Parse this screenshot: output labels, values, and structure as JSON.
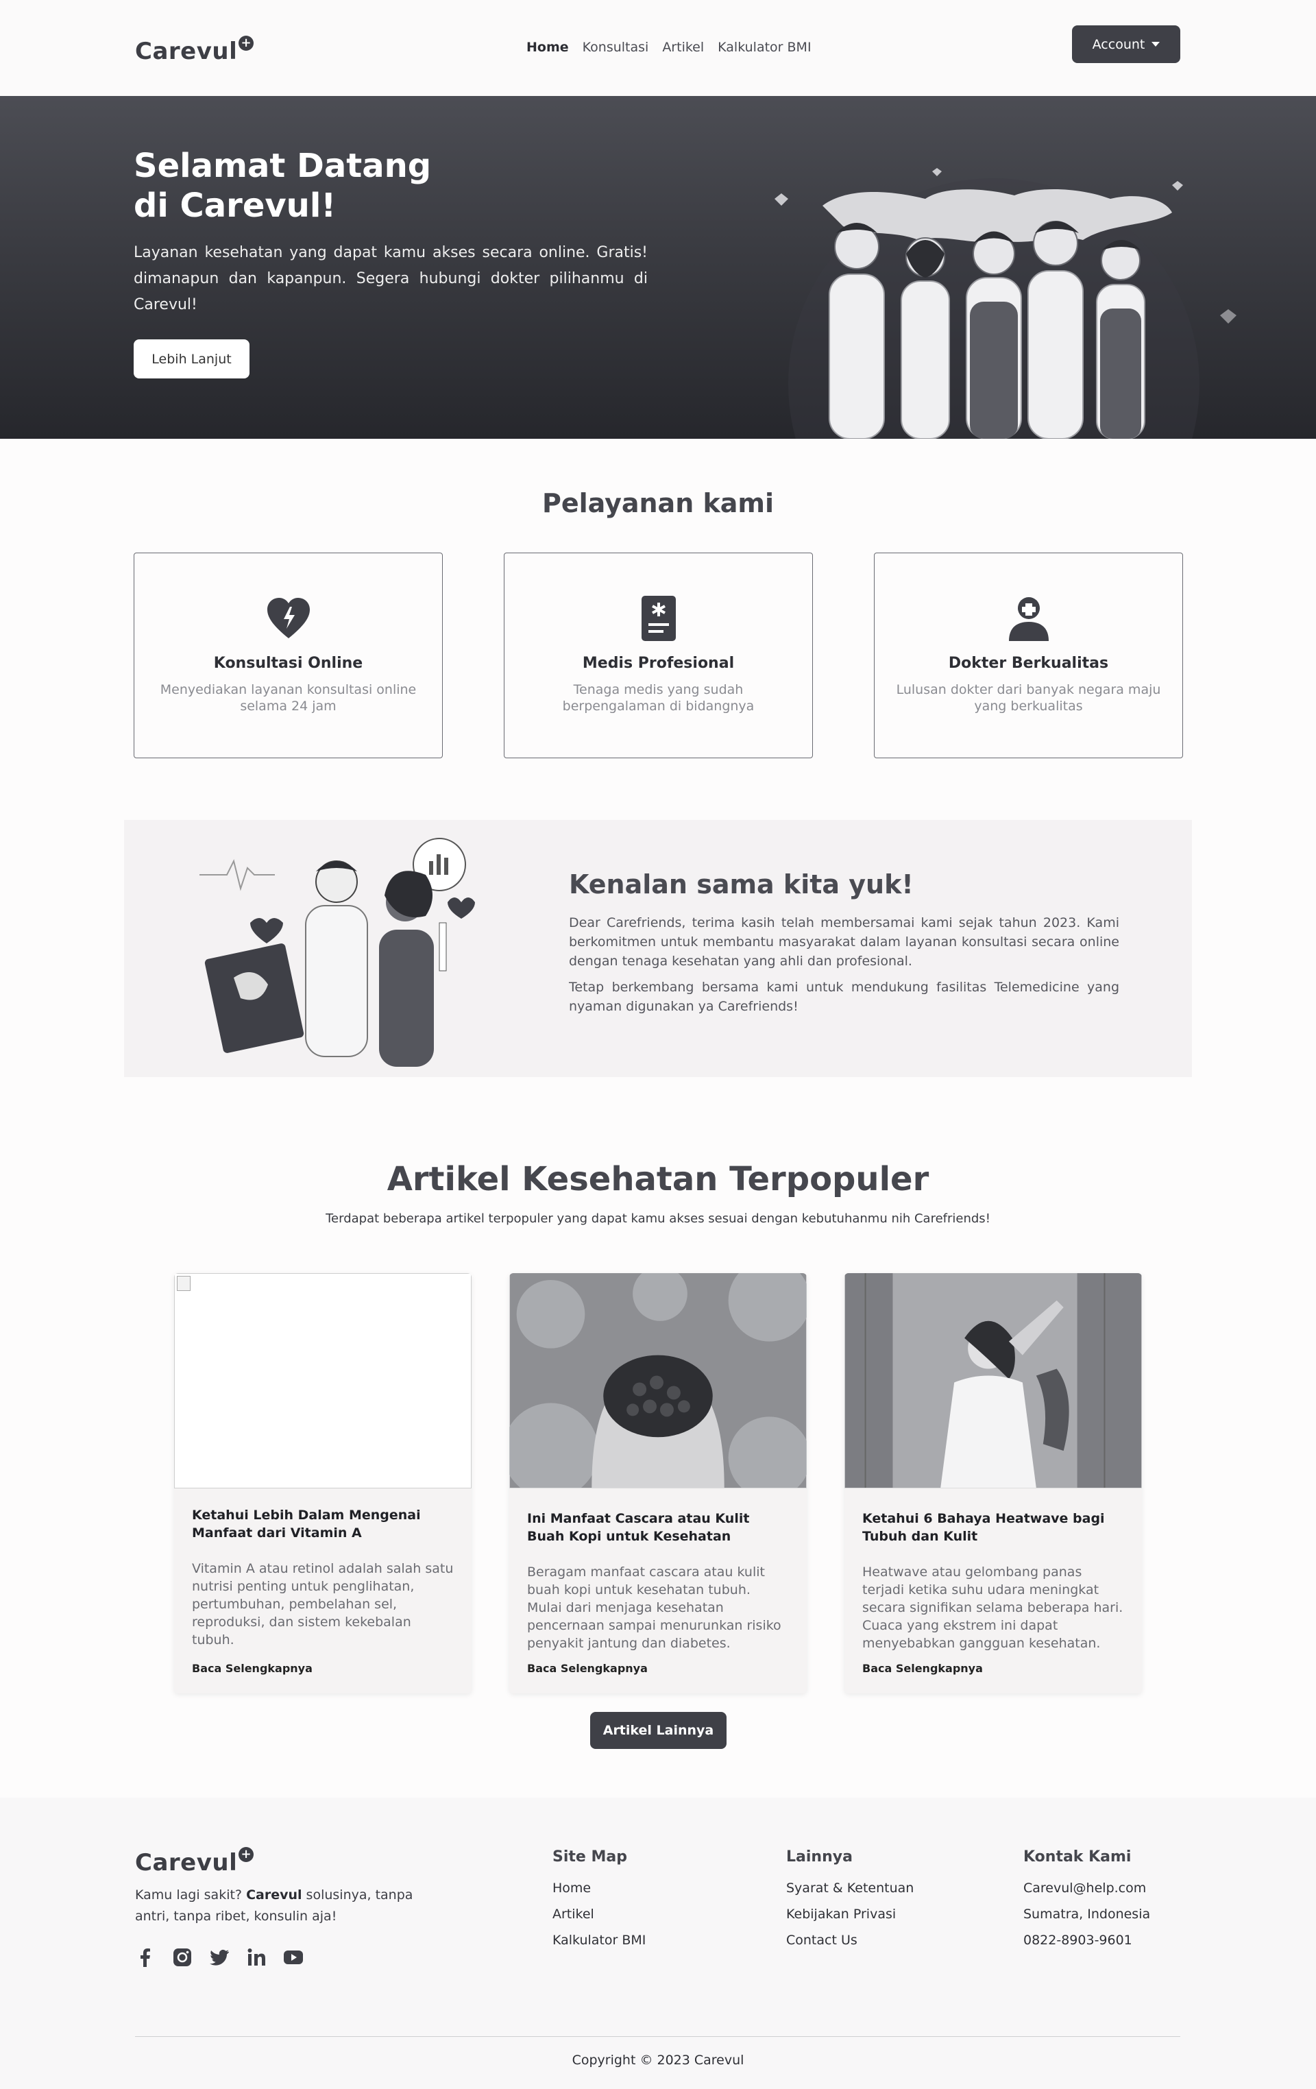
{
  "brand": {
    "name": "Carevul",
    "plus": "+"
  },
  "nav": {
    "items": [
      {
        "label": "Home",
        "active": true
      },
      {
        "label": "Konsultasi"
      },
      {
        "label": "Artikel"
      },
      {
        "label": "Kalkulator BMI"
      }
    ],
    "account_label": "Account"
  },
  "hero": {
    "title_line1": "Selamat Datang",
    "title_line2": "di Carevul!",
    "text": "Layanan kesehatan yang dapat kamu akses secara online. Gratis! dimanapun dan kapanpun. Segera hubungi dokter pilihanmu di Carevul!",
    "button": "Lebih Lanjut"
  },
  "services": {
    "title": "Pelayanan kami",
    "items": [
      {
        "icon": "heart-pulse-icon",
        "title": "Konsultasi Online",
        "desc": "Menyediakan layanan konsultasi online selama 24 jam"
      },
      {
        "icon": "medical-document-icon",
        "title": "Medis Profesional",
        "desc": "Tenaga medis yang sudah berpengalaman di bidangnya"
      },
      {
        "icon": "doctor-icon",
        "title": "Dokter Berkualitas",
        "desc": "Lulusan dokter dari banyak negara maju yang berkualitas"
      }
    ]
  },
  "about": {
    "title": "Kenalan sama kita yuk!",
    "p1": "Dear Carefriends, terima kasih telah membersamai kami sejak tahun 2023. Kami berkomitmen untuk membantu masyarakat dalam layanan konsultasi secara online dengan tenaga kesehatan yang ahli dan profesional.",
    "p2": "Tetap berkembang bersama kami untuk mendukung fasilitas Telemedicine yang nyaman digunakan ya Carefriends!"
  },
  "articles": {
    "title": "Artikel Kesehatan Terpopuler",
    "subtitle": "Terdapat beberapa artikel terpopuler yang dapat kamu akses sesuai dengan kebutuhanmu nih Carefriends!",
    "items": [
      {
        "title": "Ketahui Lebih Dalam Mengenai Manfaat dari Vitamin A",
        "desc": "Vitamin A atau retinol adalah salah satu nutrisi penting untuk penglihatan, pertumbuhan, pembelahan sel, reproduksi, dan sistem kekebalan tubuh.",
        "link": "Baca Selengkapnya"
      },
      {
        "title": "Ini Manfaat Cascara atau Kulit Buah Kopi untuk Kesehatan",
        "desc": "Beragam manfaat cascara atau kulit buah kopi untuk kesehatan tubuh. Mulai dari menjaga kesehatan pencernaan sampai menurunkan risiko penyakit jantung dan diabetes.",
        "link": "Baca Selengkapnya"
      },
      {
        "title": "Ketahui 6 Bahaya Heatwave bagi Tubuh dan Kulit",
        "desc": "Heatwave atau gelombang panas terjadi ketika suhu udara meningkat secara signifikan selama beberapa hari. Cuaca yang ekstrem ini dapat menyebabkan gangguan kesehatan.",
        "link": "Baca Selengkapnya"
      }
    ],
    "more_button": "Artikel Lainnya"
  },
  "footer": {
    "tagline_pre": "Kamu lagi sakit? ",
    "tagline_bold": "Carevul",
    "tagline_post": " solusinya, tanpa antri, tanpa ribet, konsulin aja!",
    "socials": [
      "facebook-icon",
      "instagram-icon",
      "twitter-icon",
      "linkedin-icon",
      "youtube-icon"
    ],
    "columns": [
      {
        "title": "Site Map",
        "links": [
          "Home",
          "Artikel",
          "Kalkulator BMI"
        ]
      },
      {
        "title": "Lainnya",
        "links": [
          "Syarat & Ketentuan",
          "Kebijakan Privasi",
          "Contact Us"
        ]
      },
      {
        "title": "Kontak Kami",
        "links": [
          "Carevul@help.com",
          "Sumatra, Indonesia",
          "0822-8903-9601"
        ]
      }
    ],
    "copyright": "Copyright © 2023 Carevul"
  }
}
